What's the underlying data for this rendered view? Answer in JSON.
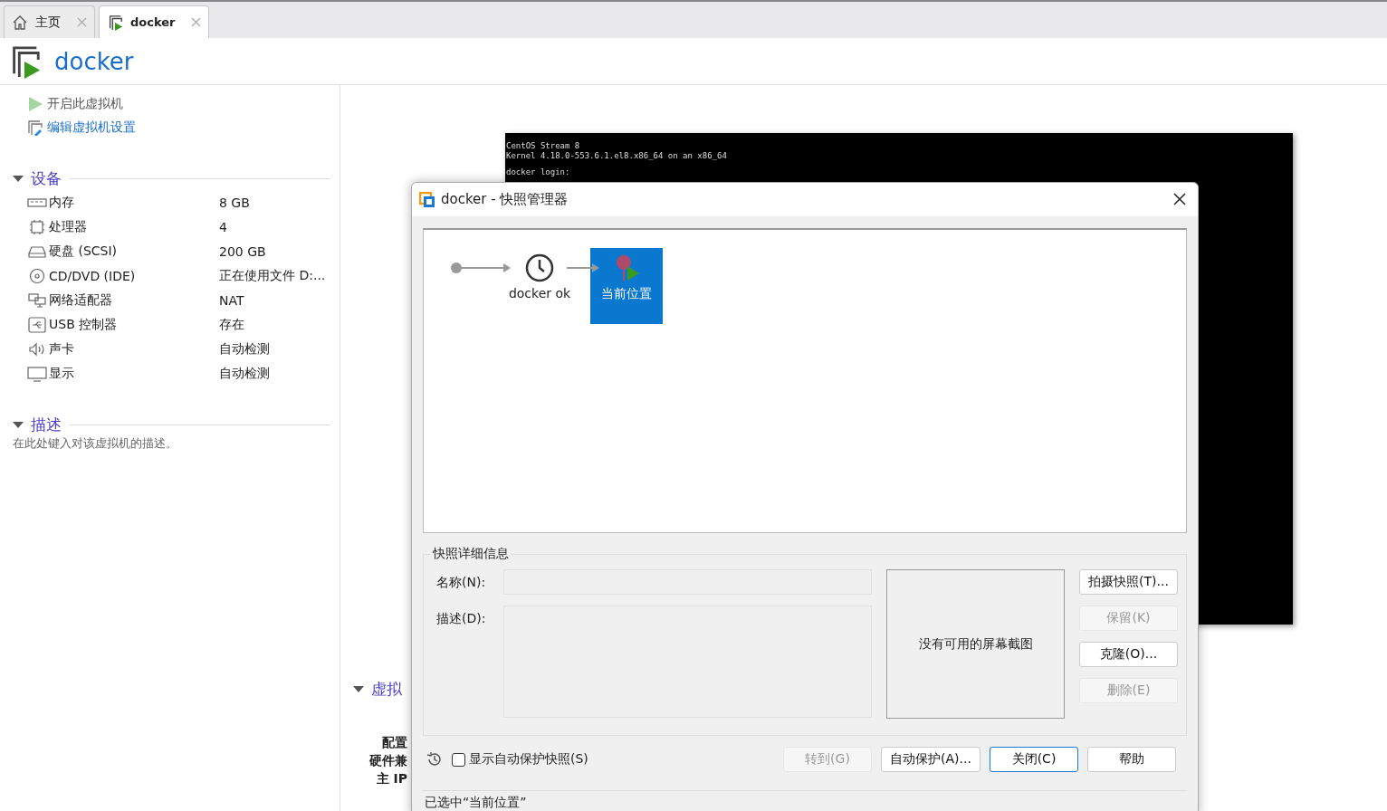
{
  "tabs": [
    {
      "label": "主页",
      "kind": "home",
      "selected": false
    },
    {
      "label": "docker",
      "kind": "vm",
      "selected": true
    }
  ],
  "vm_title": "docker",
  "actions": [
    {
      "label": "开启此虚拟机",
      "kind": "power"
    },
    {
      "label": "编辑虚拟机设置",
      "kind": "edit"
    }
  ],
  "devices": {
    "title": "设备",
    "expanded": true,
    "items": [
      {
        "name": "内存",
        "value": "8 GB",
        "kind": "memory"
      },
      {
        "name": "处理器",
        "value": "4",
        "kind": "cpu"
      },
      {
        "name": "硬盘 (SCSI)",
        "value": "200 GB",
        "kind": "disk"
      },
      {
        "name": "CD/DVD (IDE)",
        "value": "正在使用文件 D:...",
        "kind": "cdrom"
      },
      {
        "name": "网络适配器",
        "value": "NAT",
        "kind": "network"
      },
      {
        "name": "USB 控制器",
        "value": "存在",
        "kind": "usb"
      },
      {
        "name": "声卡",
        "value": "自动检测",
        "kind": "sound"
      },
      {
        "name": "显示",
        "value": "自动检测",
        "kind": "display"
      }
    ]
  },
  "description": {
    "title": "描述",
    "expanded": true,
    "placeholder": "在此处键入对该虚拟机的描述。"
  },
  "console": {
    "lines": [
      "CentOS Stream 8",
      "Kernel 4.18.0-553.6.1.el8.x86_64 on an x86_64"
    ],
    "prompt": "docker login:"
  },
  "vm_details": {
    "title": "虚拟",
    "expanded": true,
    "labels": [
      "配置",
      "硬件兼",
      "主 IP"
    ]
  },
  "dialog": {
    "title": "docker - 快照管理器",
    "snapshots": [
      {
        "label": "docker ok",
        "kind": "snapshot",
        "selected": false
      },
      {
        "label": "当前位置",
        "kind": "current",
        "selected": true
      }
    ],
    "details": {
      "title": "快照详细信息",
      "name_label": "名称(N):",
      "description_label": "描述(D):",
      "screenshot_text": "没有可用的屏幕截图"
    },
    "side_buttons": [
      {
        "label": "拍摄快照(T)...",
        "disabled": false
      },
      {
        "label": "保留(K)",
        "disabled": true
      },
      {
        "label": "克隆(O)...",
        "disabled": false
      },
      {
        "label": "删除(E)",
        "disabled": true
      }
    ],
    "show_autoprotect": {
      "label": "显示自动保护快照(S)",
      "checked": false
    },
    "bottom_buttons": [
      {
        "label": "转到(G)",
        "disabled": true,
        "focused": false
      },
      {
        "label": "自动保护(A)...",
        "disabled": false,
        "focused": false
      },
      {
        "label": "关闭(C)",
        "disabled": false,
        "focused": true
      },
      {
        "label": "帮助",
        "disabled": false,
        "focused": false
      }
    ],
    "status": "已选中“当前位置”"
  }
}
